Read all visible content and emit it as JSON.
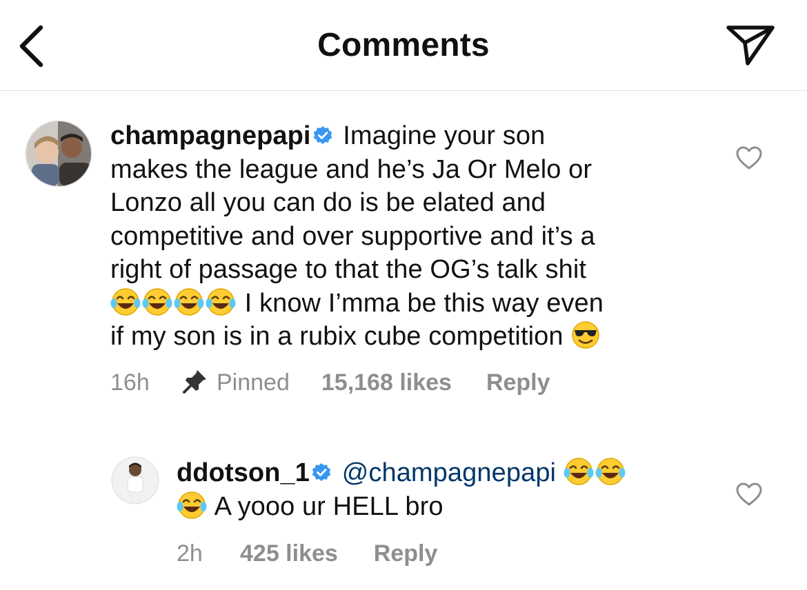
{
  "header": {
    "title": "Comments",
    "back_icon": "chevron-left-icon",
    "share_icon": "paper-plane-icon"
  },
  "comments": [
    {
      "username": "champagnepapi",
      "verified": true,
      "text_1": "Imagine your son",
      "text_2": "makes the league and he’s Ja Or Melo or",
      "text_3": "Lonzo all you can do is be elated and",
      "text_4": "competitive and over supportive and it’s a",
      "text_5": "right of passage to that the OG’s talk shit",
      "text_6": "I know I’mma be this way even",
      "text_7": "if my son is in a rubix cube competition",
      "emojis": [
        "😂",
        "😂",
        "😂",
        "😂",
        "😎"
      ],
      "time": "16h",
      "pinned_label": "Pinned",
      "likes": "15,168 likes",
      "reply_label": "Reply"
    },
    {
      "username": "ddotson_1",
      "verified": true,
      "mention": "@champagnepapi",
      "text_2": "A yooo ur HELL bro",
      "emojis": [
        "😂",
        "😂",
        "😂"
      ],
      "time": "2h",
      "likes": "425 likes",
      "reply_label": "Reply"
    }
  ],
  "colors": {
    "verified_blue": "#3897f0",
    "mention_blue": "#00376b",
    "meta_gray": "#8e8e8e",
    "divider": "#dddddd"
  }
}
